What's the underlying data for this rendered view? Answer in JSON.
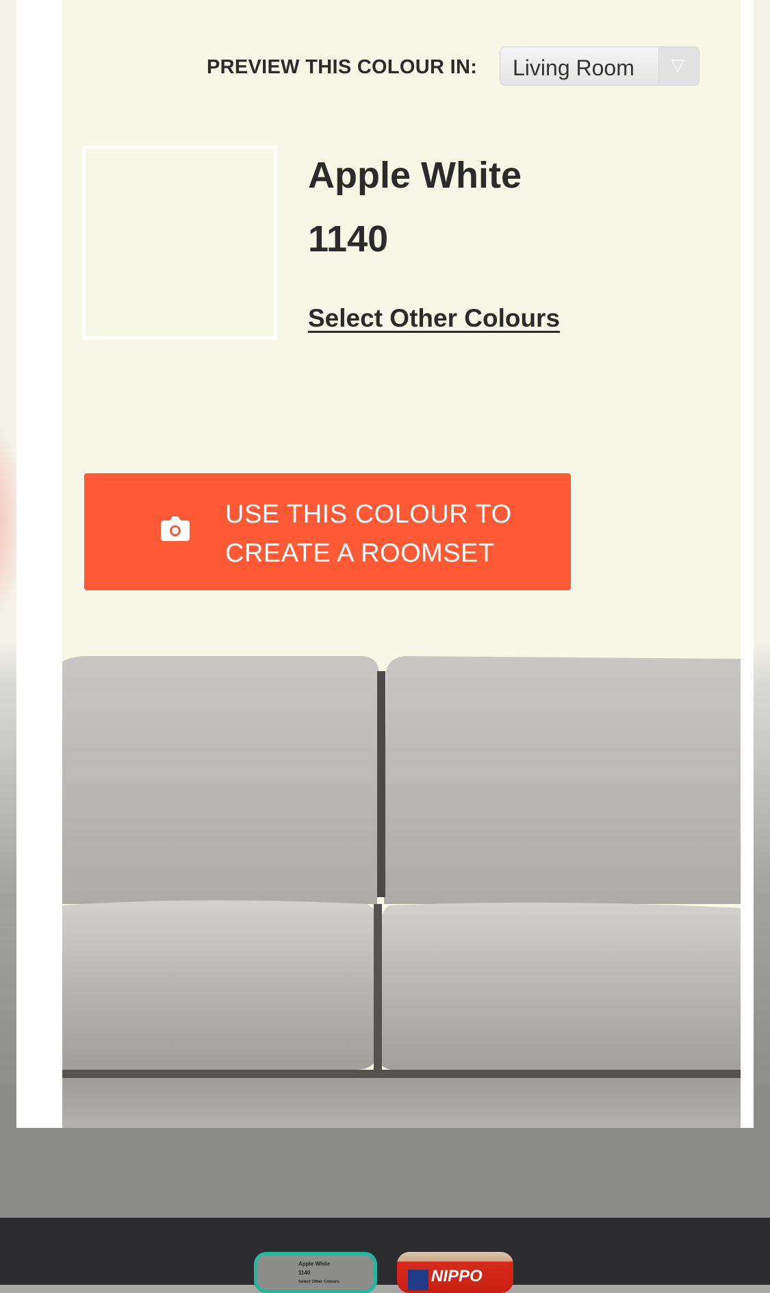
{
  "preview": {
    "label": "PREVIEW THIS COLOUR IN:",
    "selected_room": "Living Room"
  },
  "colour": {
    "name": "Apple White",
    "code": "1140",
    "swatch_hex": "#f7f7e7",
    "select_other_label": "Select Other Colours"
  },
  "cta": {
    "line1": "USE THIS COLOUR TO",
    "line2": "CREATE A ROOMSET",
    "icon": "camera-icon",
    "color": "#ff5a35"
  },
  "tabs": [
    {
      "thumb_line1": "Apple White",
      "thumb_line2": "1140",
      "thumb_line3": "Select Other Colours",
      "active": true,
      "accent": "#25b6a0"
    },
    {
      "brand_text": "NIPPO",
      "active": false
    }
  ]
}
